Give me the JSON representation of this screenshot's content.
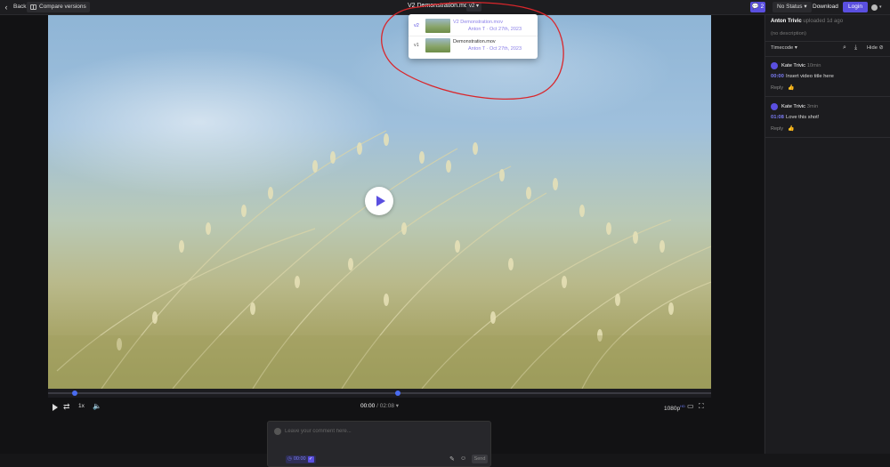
{
  "header": {
    "back_label": "Back",
    "compare_label": "Compare versions",
    "title": "V2 Demonstration.mov",
    "version_selector": "v2",
    "comment_count": "2",
    "status_label": "No Status",
    "download_label": "Download",
    "login_label": "Login"
  },
  "version_popup": {
    "versions": [
      {
        "tag": "v2",
        "name": "V2 Demonstration.mov",
        "meta": "Anton T · Oct 27th, 2023"
      },
      {
        "tag": "v1",
        "name": "Demonstration.mov",
        "meta": "Anton T · Oct 27th, 2023"
      }
    ]
  },
  "player": {
    "speed": "1x",
    "current_time": "00:00",
    "duration": "02:08",
    "resolution": "1080p",
    "resolution_badge": "HD",
    "progress": 0.0
  },
  "comment_box": {
    "placeholder": "Leave your comment here...",
    "timestamp": "00:00",
    "send_label": "Send"
  },
  "panel": {
    "owner": "Anton Trivic",
    "uploaded": "uploaded 1d ago",
    "description": "(no description)",
    "sort_label": "Timecode",
    "hide_label": "Hide",
    "comments": [
      {
        "author": "Kate Trivic",
        "age": "10min",
        "time": "00:00",
        "text": "Insert video title here",
        "reply": "Reply"
      },
      {
        "author": "Kate Trivic",
        "age": "3min",
        "time": "01:08",
        "text": "Love this shot!",
        "reply": "Reply"
      }
    ]
  },
  "colors": {
    "accent": "#5a4fe0",
    "annotation": "#d9262b",
    "timecode": "#7b7cf5"
  }
}
